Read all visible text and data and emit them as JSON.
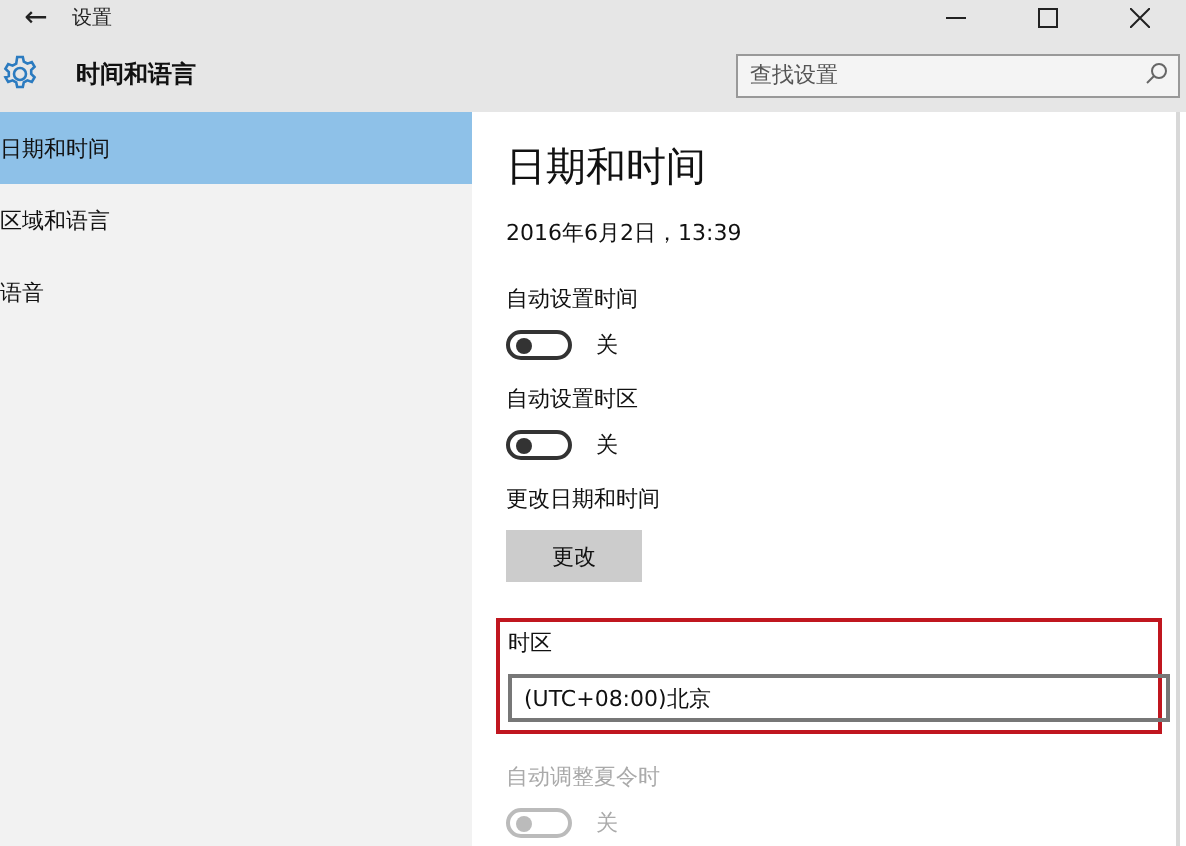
{
  "window": {
    "back": "←",
    "title": "设置"
  },
  "header": {
    "title": "时间和语言",
    "search": {
      "placeholder": "查找设置"
    }
  },
  "sidebar": {
    "items": [
      {
        "label": "日期和时间",
        "selected": true
      },
      {
        "label": "区域和语言",
        "selected": false
      },
      {
        "label": "语音",
        "selected": false
      }
    ]
  },
  "content": {
    "heading": "日期和时间",
    "current": "2016年6月2日，13:39",
    "settings": [
      {
        "kind": "toggle",
        "label": "自动设置时间",
        "on": false,
        "state": "关",
        "disabled": false
      },
      {
        "kind": "toggle",
        "label": "自动设置时区",
        "on": false,
        "state": "关",
        "disabled": false
      },
      {
        "kind": "button",
        "label": "更改日期和时间",
        "button": "更改"
      },
      {
        "kind": "dropdown",
        "label": "时区",
        "value": "(UTC+08:00)北京",
        "highlighted": true
      },
      {
        "kind": "toggle",
        "label": "自动调整夏令时",
        "on": false,
        "state": "关",
        "disabled": true
      }
    ]
  }
}
